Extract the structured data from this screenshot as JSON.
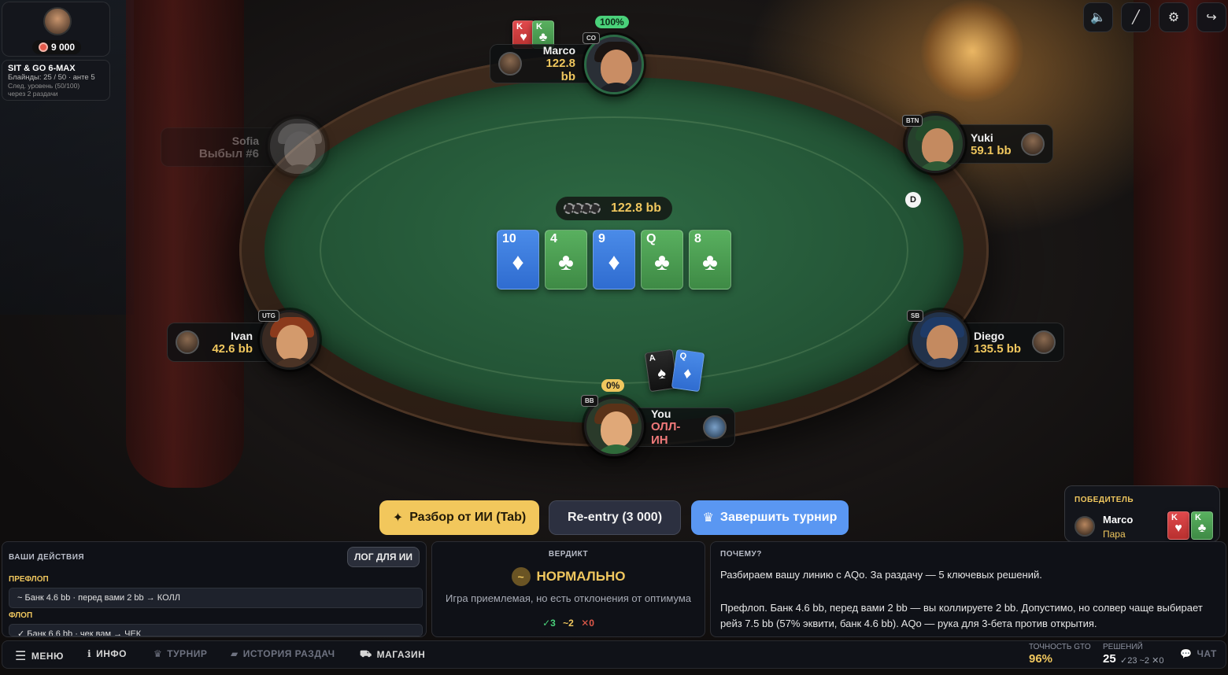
{
  "profile": {
    "chips": "9 000"
  },
  "tournament": {
    "title": "SIT & GO 6-MAX",
    "blinds": "Блайнды: 25 / 50 · анте 5",
    "next_level": "След. уровень (50/100)",
    "next_level_when": "через 2 раздачи"
  },
  "top_icons": [
    "mute-icon",
    "pen-icon",
    "gear-icon",
    "exit-icon"
  ],
  "pot": {
    "value": "122.8 bb"
  },
  "board": [
    {
      "rank": "10",
      "suit": "♦",
      "color": "blue"
    },
    {
      "rank": "4",
      "suit": "♣",
      "color": "green"
    },
    {
      "rank": "9",
      "suit": "♦",
      "color": "blue"
    },
    {
      "rank": "Q",
      "suit": "♣",
      "color": "green"
    },
    {
      "rank": "8",
      "suit": "♣",
      "color": "green"
    }
  ],
  "players": {
    "marco": {
      "name": "Marco",
      "stack": "122.8 bb",
      "position": "CO",
      "equity": "100%",
      "cards": [
        {
          "rank": "K",
          "suit": "♥"
        },
        {
          "rank": "K",
          "suit": "♣"
        }
      ]
    },
    "sofia": {
      "name": "Sofia",
      "status": "Выбыл #6"
    },
    "yuki": {
      "name": "Yuki",
      "stack": "59.1 bb",
      "position": "BTN"
    },
    "ivan": {
      "name": "Ivan",
      "stack": "42.6 bb",
      "position": "UTG"
    },
    "diego": {
      "name": "Diego",
      "stack": "135.5 bb",
      "position": "SB"
    },
    "you": {
      "name": "You",
      "status": "ОЛЛ-ИН",
      "position": "BB",
      "equity": "0%",
      "cards": [
        {
          "rank": "A",
          "suit": "♠"
        },
        {
          "rank": "Q",
          "suit": "♦"
        }
      ]
    }
  },
  "dealer_button": "D",
  "actions": {
    "ai_review": "Разбор от ИИ (Tab)",
    "reentry": "Re-entry (3 000)",
    "finish": "Завершить турнир"
  },
  "winner": {
    "title": "ПОБЕДИТЕЛЬ",
    "name": "Marco",
    "hand": "Пара",
    "cards": [
      {
        "rank": "K",
        "suit": "♥"
      },
      {
        "rank": "K",
        "suit": "♣"
      }
    ]
  },
  "your_actions": {
    "title": "ВАШИ ДЕЙСТВИЯ",
    "log_button": "ЛОГ ДЛЯ ИИ",
    "streets": [
      {
        "name": "ПРЕФЛОП",
        "line": "~   Банк 4.6 bb · перед вами 2 bb → КОЛЛ"
      },
      {
        "name": "ФЛОП",
        "line": "✓   Банк 6.6 bb · чек вам → ЧЕК"
      }
    ]
  },
  "verdict": {
    "title": "ВЕРДИКТ",
    "icon": "~",
    "label": "НОРМАЛЬНО",
    "description": "Игра приемлемая, но есть отклонения от оптимума",
    "ok": "✓3",
    "mid": "~2",
    "bad": "✕0"
  },
  "why": {
    "title": "ПОЧЕМУ?",
    "p1": "Разбираем вашу линию с AQo. За раздачу — 5 ключевых решений.",
    "p2": "Префлоп. Банк 4.6 bb, перед вами 2 bb — вы коллируете 2 bb. Допустимо, но солвер чаще выбирает рейз 7.5 bb (57% эквити, банк 4.6 bb). AQo — рука для 3-бета против открытия."
  },
  "nav": {
    "menu": "МЕНЮ",
    "info": "ИНФО",
    "tournament": "ТУРНИР",
    "history": "ИСТОРИЯ РАЗДАЧ",
    "shop": "МАГАЗИН",
    "gto_label": "ТОЧНОСТЬ GTO",
    "gto_value": "96%",
    "decisions_label": "РЕШЕНИЙ",
    "decisions_value": "25",
    "decisions_detail": "✓23 ~2 ✕0",
    "chat": "ЧАТ"
  },
  "colors": {
    "accent": "#f0c75e",
    "felt": "#245637",
    "blue_card": "#3a7ddc",
    "green_card": "#4a9c50",
    "finish_button": "#5a97f2"
  }
}
